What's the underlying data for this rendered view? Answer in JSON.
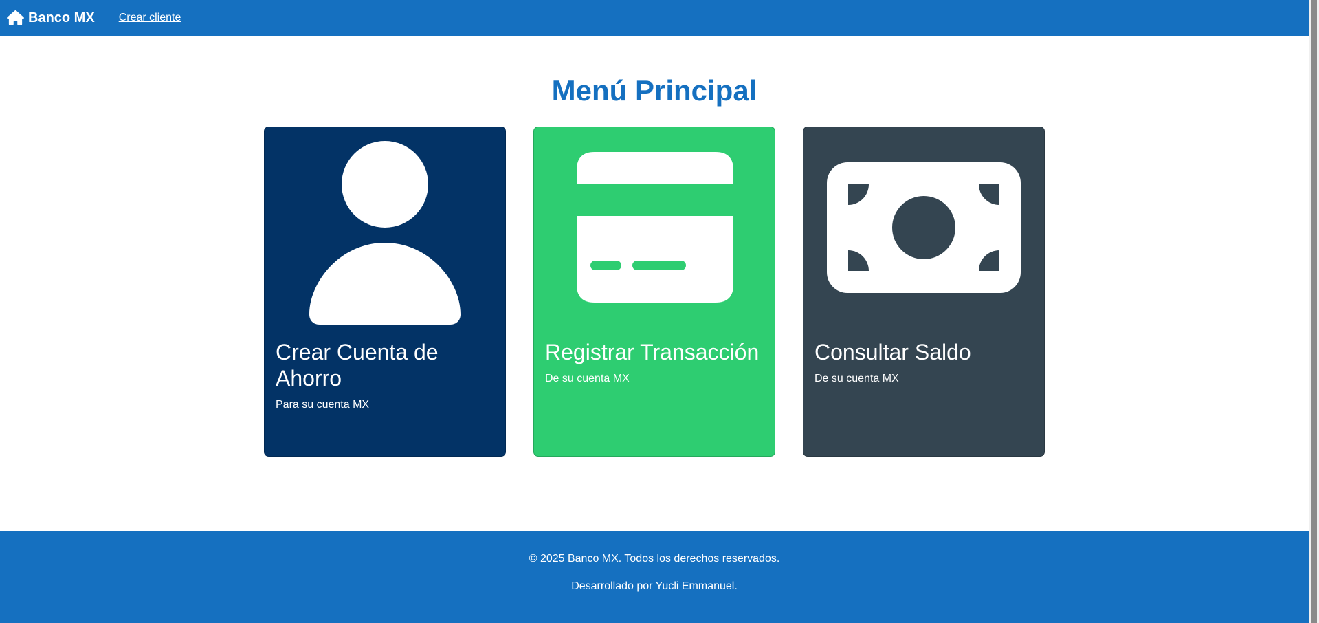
{
  "navbar": {
    "brand_icon": "home-icon",
    "brand": "Banco MX",
    "links": [
      {
        "label": "Crear cliente"
      }
    ]
  },
  "main": {
    "title": "Menú Principal",
    "cards": [
      {
        "icon": "person-icon",
        "title": "Crear Cuenta de Ahorro",
        "text": "Para su cuenta MX",
        "color": "#033366"
      },
      {
        "icon": "credit-card-icon",
        "title": "Registrar Transacción",
        "text": "De su cuenta MX",
        "color": "#2ecd71"
      },
      {
        "icon": "cash-icon",
        "title": "Consultar Saldo",
        "text": "De su cuenta MX",
        "color": "#344551"
      }
    ]
  },
  "footer": {
    "copyright": "© 2025 Banco MX. Todos los derechos reservados.",
    "credit": "Desarrollado por Yucli Emmanuel."
  },
  "colors": {
    "primary": "#1570c0",
    "background": "#ffffff"
  }
}
